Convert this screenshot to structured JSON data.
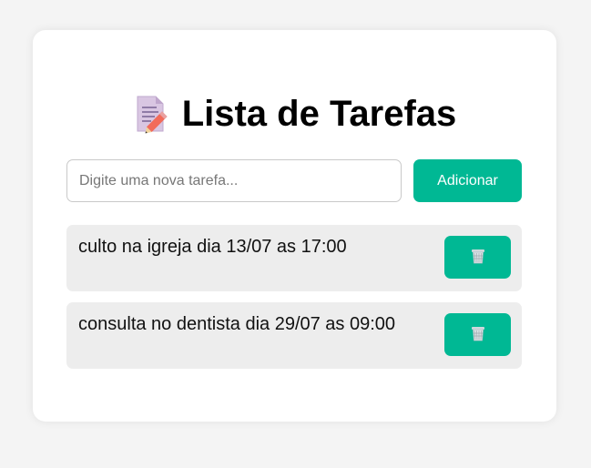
{
  "header": {
    "title": "Lista de Tarefas",
    "icon": "memo-pencil-icon"
  },
  "form": {
    "placeholder": "Digite uma nova tarefa...",
    "value": "",
    "add_label": "Adicionar"
  },
  "tasks": [
    {
      "text": "culto na igreja dia 13/07 as 17:00",
      "delete_icon": "wastebasket-icon"
    },
    {
      "text": "consulta no dentista dia 29/07 as 09:00",
      "delete_icon": "wastebasket-icon"
    }
  ],
  "colors": {
    "accent": "#00b894",
    "background": "#f4f4f4",
    "card": "#ffffff",
    "task_bg": "#ededed"
  }
}
